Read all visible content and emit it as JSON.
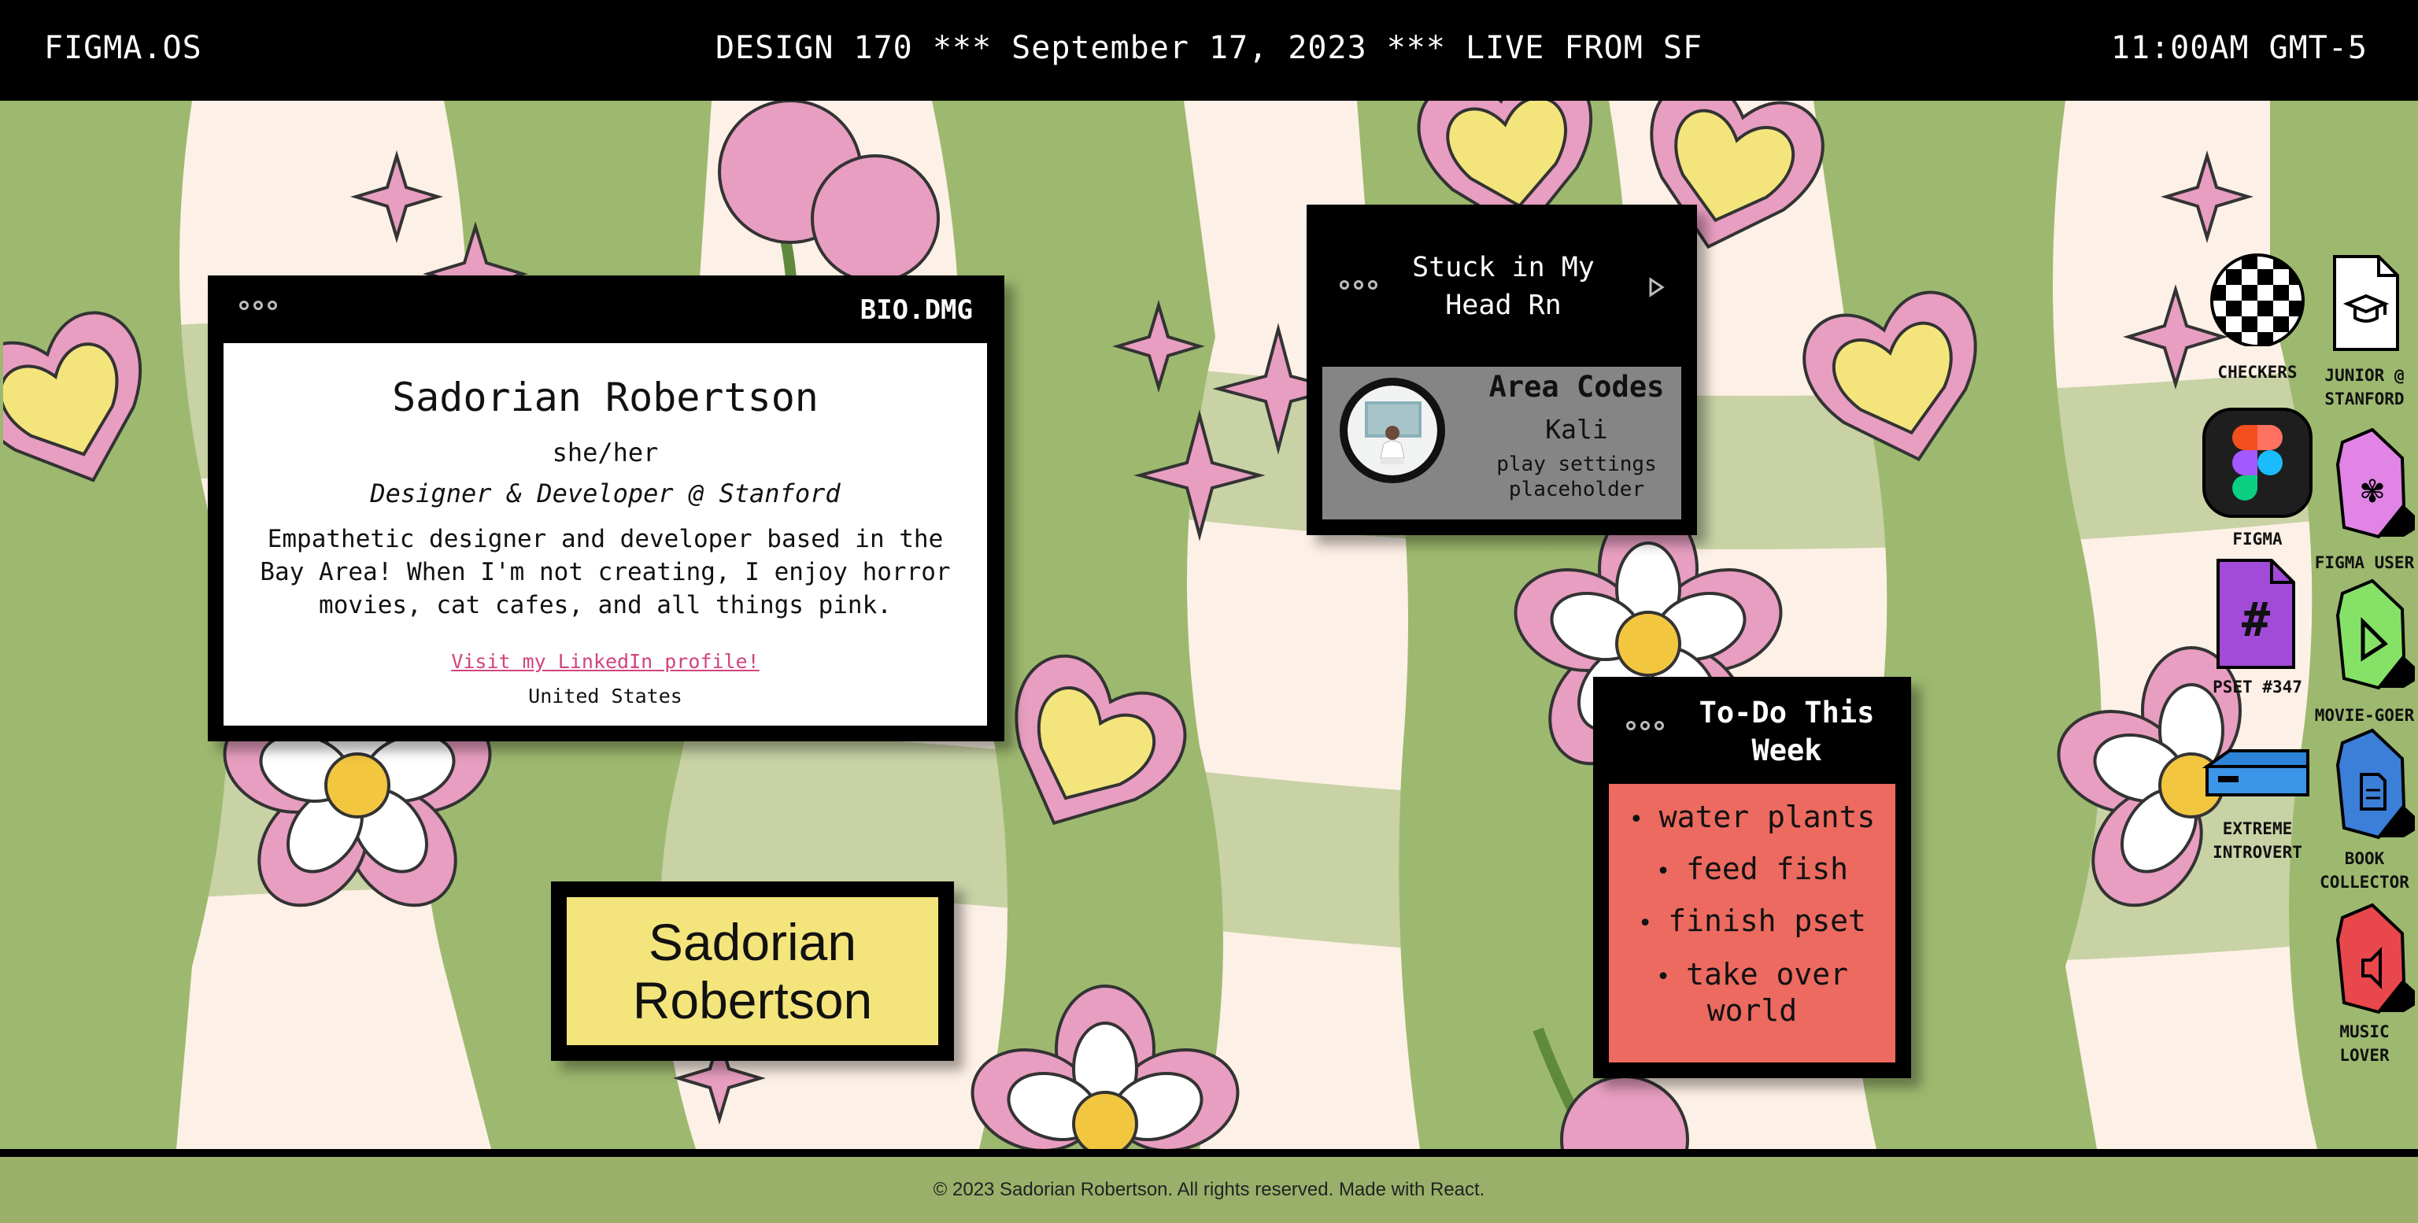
{
  "topbar": {
    "os_name": "FIGMA.OS",
    "headline": "DESIGN 170 *** September 17, 2023 *** LIVE FROM SF",
    "clock": "11:00AM GMT-5"
  },
  "bio_window": {
    "title": "BIO.DMG",
    "name": "Sadorian Robertson",
    "pronouns": "she/her",
    "role": "Designer & Developer @ Stanford",
    "about_lines": [
      "Empathetic designer and developer based in the",
      "Bay Area! When I'm not creating, I enjoy horror",
      "movies, cat cafes, and all things pink."
    ],
    "link_text": "Visit my LinkedIn profile!",
    "country": "United States"
  },
  "music_window": {
    "title_lines": [
      "Stuck in My",
      "Head Rn"
    ],
    "song": "Area Codes",
    "artist": "Kali",
    "status_lines": [
      "play settings",
      "placeholder"
    ]
  },
  "todo_window": {
    "title_lines": [
      "To-Do This",
      "Week"
    ],
    "items": [
      "water plants",
      "feed fish",
      "finish pset",
      "take over",
      "world"
    ]
  },
  "name_tag": {
    "lines": [
      "Sadorian",
      "Robertson"
    ]
  },
  "desktop_icons": [
    {
      "icon": "checkers-icon",
      "label_lines": [
        "CHECKERS"
      ]
    },
    {
      "icon": "graduation-cap-file-icon",
      "label_lines": [
        "JUNIOR @",
        "STANFORD"
      ]
    },
    {
      "icon": "figma-app-icon",
      "label_lines": [
        "FIGMA"
      ]
    },
    {
      "icon": "figma-folder-icon",
      "label_lines": [
        "FIGMA USER"
      ]
    },
    {
      "icon": "hash-file-icon",
      "label_lines": [
        "PSET #347"
      ]
    },
    {
      "icon": "play-folder-icon",
      "label_lines": [
        "MOVIE-GOER"
      ]
    },
    {
      "icon": "hard-drive-icon",
      "label_lines": [
        "EXTREME",
        "INTROVERT"
      ]
    },
    {
      "icon": "book-folder-icon",
      "label_lines": [
        "BOOK",
        "COLLECTOR"
      ]
    },
    {
      "icon": "music-folder-icon",
      "label_lines": [
        "MUSIC",
        "LOVER"
      ]
    }
  ],
  "footer": {
    "text": "© 2023 Sadorian Robertson. All rights reserved. Made with React."
  },
  "colors": {
    "wallpaper_green": "#9db96f",
    "wallpaper_cream": "#fdf0e6",
    "bio_link": "#d0457c",
    "music_player": "#858585",
    "todo_body": "#ec6a5f",
    "name_plate": "#f4e47c",
    "footer": "#9ab06a"
  }
}
